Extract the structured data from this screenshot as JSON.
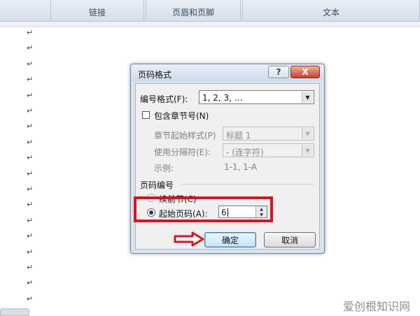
{
  "ribbon": {
    "groups": [
      "链接",
      "页眉和页脚",
      "文本"
    ]
  },
  "document": {
    "paragraph_mark": "↵",
    "mark_count": 18
  },
  "watermark": "爱创根知识网",
  "dialog": {
    "title": "页码格式",
    "help_label": "?",
    "close_label": "X",
    "number_format": {
      "label": "编号格式(F):",
      "value": "1, 2, 3, …"
    },
    "include_chapter": {
      "label": "包含章节号(N)",
      "checked": false
    },
    "chapter_style": {
      "label": "章节起始样式(P)",
      "value": "标题 1"
    },
    "separator": {
      "label": "使用分隔符(E):",
      "value": "-  (连字符)"
    },
    "example": {
      "label": "示例:",
      "value": "1-1, 1-A"
    },
    "page_numbering": {
      "label": "页码编号",
      "continue_label": "续前节(C)",
      "start_at_label": "起始页码(A):",
      "start_at_value": "6"
    },
    "ok_label": "确定",
    "cancel_label": "取消"
  },
  "colors": {
    "highlight": "#e0101d",
    "dialog_bg": "#d9e4f1",
    "close_button": "#c4422a"
  }
}
